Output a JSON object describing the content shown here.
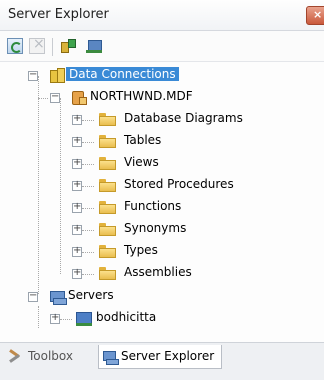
{
  "window": {
    "title": "Server Explorer",
    "close_glyph": "×",
    "accent": "#3a8ad6"
  },
  "toolbar": {
    "buttons": [
      {
        "name": "refresh",
        "icon": "refresh-icon",
        "enabled": true
      },
      {
        "name": "stop-refresh",
        "icon": "stop-icon",
        "enabled": false
      },
      {
        "name": "connect-to-database",
        "icon": "connect-database-icon",
        "enabled": true
      },
      {
        "name": "connect-to-server",
        "icon": "connect-server-icon",
        "enabled": true
      }
    ]
  },
  "tree": {
    "data_connections": {
      "label": "Data Connections",
      "expanded": true,
      "selected": true,
      "icon": "data-connections-icon",
      "database": {
        "label": "NORTHWND.MDF",
        "expanded": true,
        "icon": "database-icon",
        "folders": [
          {
            "label": "Database Diagrams"
          },
          {
            "label": "Tables"
          },
          {
            "label": "Views"
          },
          {
            "label": "Stored Procedures"
          },
          {
            "label": "Functions"
          },
          {
            "label": "Synonyms"
          },
          {
            "label": "Types"
          },
          {
            "label": "Assemblies"
          }
        ]
      }
    },
    "servers": {
      "label": "Servers",
      "expanded": true,
      "icon": "servers-icon",
      "children": [
        {
          "label": "bodhicitta",
          "icon": "server-icon",
          "expanded": false
        }
      ]
    }
  },
  "tabs": [
    {
      "label": "Toolbox",
      "icon": "toolbox-icon",
      "active": false
    },
    {
      "label": "Server Explorer",
      "icon": "server-explorer-icon",
      "active": true
    }
  ]
}
